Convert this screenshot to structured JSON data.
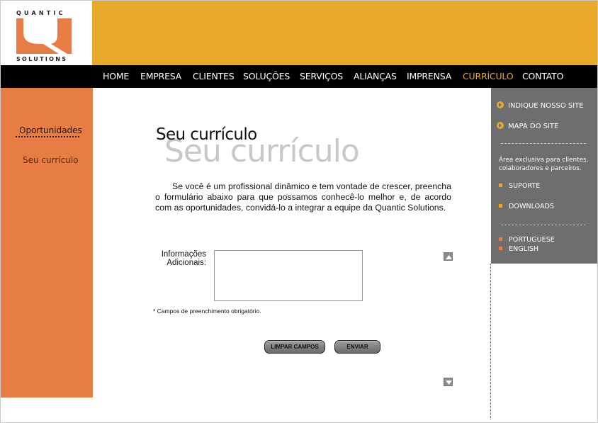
{
  "brand": {
    "logo_top": "QUANTIC",
    "logo_bottom": "SOLUTIONS",
    "colors": {
      "orange": "#e77d45",
      "gold": "#e8a92b",
      "gray": "#6e6e6e",
      "black": "#000000"
    }
  },
  "nav": {
    "items": [
      {
        "label": "HOME"
      },
      {
        "label": "EMPRESA"
      },
      {
        "label": "CLIENTES"
      },
      {
        "label": "SOLUÇÕES"
      },
      {
        "label": "SERVIÇOS"
      },
      {
        "label": "ALIANÇAS"
      },
      {
        "label": "IMPRENSA"
      },
      {
        "label": "CURRÍCULO"
      },
      {
        "label": "CONTATO"
      }
    ],
    "active": "CURRÍCULO"
  },
  "left": {
    "title": "Oportunidades",
    "link": "Seu currículo"
  },
  "main": {
    "title": "Seu currículo",
    "title_shadow": "Seu currículo",
    "intro": "Se você é um profissional dinâmico e tem vontade de crescer, preencha o formulário abaixo para que possamos conhecê-lo melhor e, de acordo com as oportunidades, convidá-lo a integrar a equipe da Quantic Solutions.",
    "form": {
      "label_line1": "Informações",
      "label_line2": "Adicionais:",
      "value": "",
      "required_note": "* Campos de preenchimento obrigatório."
    },
    "buttons": {
      "clear": "LIMPAR CAMPOS",
      "send": "ENVIAR"
    },
    "scroll_icons": [
      "scroll-up-icon",
      "scroll-down-icon"
    ]
  },
  "right": {
    "links": [
      {
        "label": "INDIQUE NOSSO SITE",
        "icon": "arrow-circle-icon"
      },
      {
        "label": "MAPA DO SITE",
        "icon": "arrow-circle-icon"
      }
    ],
    "exclusive_text": "Área exclusiva para clientes, colaboradores e parceiros.",
    "area_links": [
      {
        "label": "SUPORTE"
      },
      {
        "label": "DOWNLOADS"
      }
    ],
    "languages": [
      {
        "label": "PORTUGUESE"
      },
      {
        "label": "ENGLISH"
      }
    ]
  }
}
